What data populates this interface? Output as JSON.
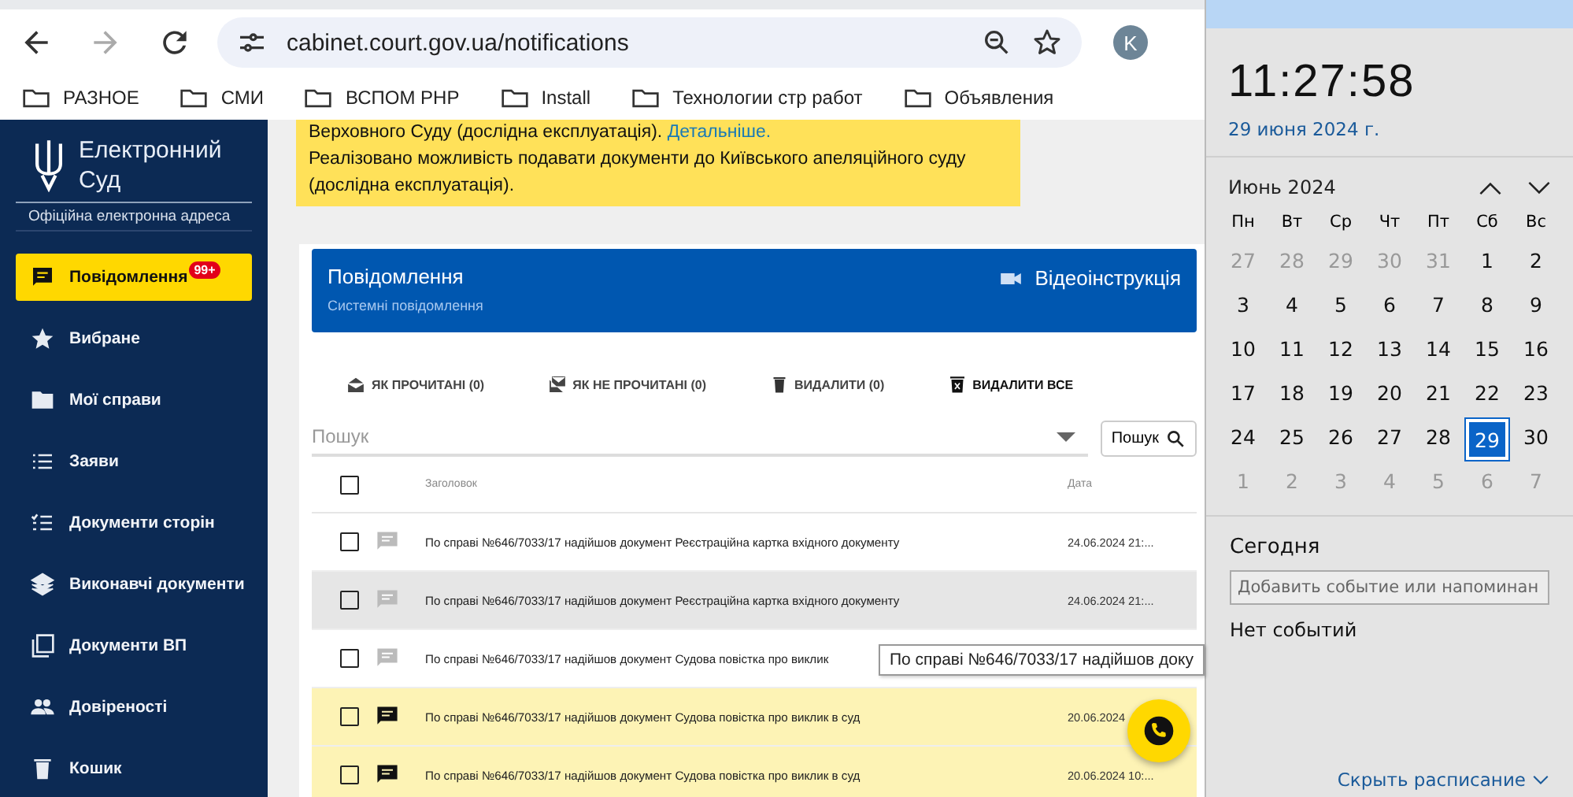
{
  "browser": {
    "url": "cabinet.court.gov.ua/notifications",
    "profile": "K",
    "bookmarks": [
      "РАЗНОЕ",
      "СМИ",
      "ВСПОМ РНР",
      "Install",
      "Технологии стр работ",
      "Объявления"
    ]
  },
  "notice": {
    "line_1": "Верховного Суду (дослідна експлуатація). ",
    "link": "Детальніше.",
    "line_2": "Реалізовано можливість подавати документи до Київського апеляційного суду (дослідна експлуатація)."
  },
  "sidebar": {
    "logo_line_1": "Електронний",
    "logo_line_2": "Суд",
    "subtitle": "Офіційна електронна адреса",
    "items": [
      {
        "label": "Повідомлення",
        "kind": "message",
        "badge": "99+",
        "selected": true
      },
      {
        "label": "Вибране",
        "kind": "star",
        "selected": false
      },
      {
        "label": "Мої справи",
        "kind": "folder",
        "selected": false
      },
      {
        "label": "Заяви",
        "kind": "list",
        "selected": false
      },
      {
        "label": "Документи сторін",
        "kind": "checklist",
        "selected": false
      },
      {
        "label": "Виконавчі документи",
        "kind": "layers",
        "selected": false
      },
      {
        "label": "Документи ВП",
        "kind": "copy",
        "selected": false
      },
      {
        "label": "Довіреності",
        "kind": "people",
        "selected": false
      },
      {
        "label": "Кошик",
        "kind": "trash",
        "selected": false
      }
    ]
  },
  "panel": {
    "title": "Повідомлення",
    "subtitle": "Системні повідомлення",
    "video_link": "Відеоінструкція"
  },
  "actions": [
    {
      "label": "ЯК ПРОЧИТАНІ (0)",
      "kind": "read"
    },
    {
      "label": "ЯК НЕ ПРОЧИТАНІ (0)",
      "kind": "unread"
    },
    {
      "label": "ВИДАЛИТИ (0)",
      "kind": "delete"
    },
    {
      "label": "ВИДАЛИТИ ВСЕ",
      "kind": "delete_all"
    }
  ],
  "search": {
    "placeholder": "Пошук",
    "button": "Пошук"
  },
  "table": {
    "columns": [
      "Заголовок",
      "Дата"
    ],
    "select_all_checked": false,
    "rows": [
      {
        "title": "По справі №646/7033/17 надійшов документ Реєстраційна картка вхідного документу",
        "date": "24.06.2024 21:...",
        "unread": false,
        "highlighted": false,
        "checked": false
      },
      {
        "title": "По справі №646/7033/17 надійшов документ Реєстраційна картка вхідного документу",
        "date": "24.06.2024 21:...",
        "unread": false,
        "highlighted": true,
        "checked": false
      },
      {
        "title": "По справі №646/7033/17 надійшов документ Судова повістка про виклик",
        "unread": false,
        "highlighted": false,
        "checked": false
      },
      {
        "title": "По справі №646/7033/17 надійшов документ Судова повістка про виклик в суд",
        "date": "20.06.2024",
        "unread": true,
        "highlighted": false,
        "checked": false
      },
      {
        "title": "По справі №646/7033/17 надійшов документ Судова повістка про виклик в суд",
        "date": "20.06.2024 10:...",
        "unread": true,
        "highlighted": false,
        "checked": false
      }
    ]
  },
  "tooltip": "По справі №646/7033/17 надійшов доку",
  "calendar": {
    "time": "11:27:58",
    "date": "29 июня 2024 г.",
    "month": "Июнь 2024",
    "weekdays": [
      "Пн",
      "Вт",
      "Ср",
      "Чт",
      "Пт",
      "Сб",
      "Вс"
    ],
    "weeks": [
      [
        {
          "d": "27",
          "outside": true,
          "selected": false
        },
        {
          "d": "28",
          "outside": true,
          "selected": false
        },
        {
          "d": "29",
          "outside": true,
          "selected": false
        },
        {
          "d": "30",
          "outside": true,
          "selected": false
        },
        {
          "d": "31",
          "outside": true,
          "selected": false
        },
        {
          "d": "1",
          "outside": false,
          "selected": false
        },
        {
          "d": "2",
          "outside": false,
          "selected": false
        }
      ],
      [
        {
          "d": "3",
          "outside": false,
          "selected": false
        },
        {
          "d": "4",
          "outside": false,
          "selected": false
        },
        {
          "d": "5",
          "outside": false,
          "selected": false
        },
        {
          "d": "6",
          "outside": false,
          "selected": false
        },
        {
          "d": "7",
          "outside": false,
          "selected": false
        },
        {
          "d": "8",
          "outside": false,
          "selected": false
        },
        {
          "d": "9",
          "outside": false,
          "selected": false
        }
      ],
      [
        {
          "d": "10",
          "outside": false,
          "selected": false
        },
        {
          "d": "11",
          "outside": false,
          "selected": false
        },
        {
          "d": "12",
          "outside": false,
          "selected": false
        },
        {
          "d": "13",
          "outside": false,
          "selected": false
        },
        {
          "d": "14",
          "outside": false,
          "selected": false
        },
        {
          "d": "15",
          "outside": false,
          "selected": false
        },
        {
          "d": "16",
          "outside": false,
          "selected": false
        }
      ],
      [
        {
          "d": "17",
          "outside": false,
          "selected": false
        },
        {
          "d": "18",
          "outside": false,
          "selected": false
        },
        {
          "d": "19",
          "outside": false,
          "selected": false
        },
        {
          "d": "20",
          "outside": false,
          "selected": false
        },
        {
          "d": "21",
          "outside": false,
          "selected": false
        },
        {
          "d": "22",
          "outside": false,
          "selected": false
        },
        {
          "d": "23",
          "outside": false,
          "selected": false
        }
      ],
      [
        {
          "d": "24",
          "outside": false,
          "selected": false
        },
        {
          "d": "25",
          "outside": false,
          "selected": false
        },
        {
          "d": "26",
          "outside": false,
          "selected": false
        },
        {
          "d": "27",
          "outside": false,
          "selected": false
        },
        {
          "d": "28",
          "outside": false,
          "selected": false
        },
        {
          "d": "29",
          "outside": false,
          "selected": true
        },
        {
          "d": "30",
          "outside": false,
          "selected": false
        }
      ],
      [
        {
          "d": "1",
          "outside": true,
          "selected": false
        },
        {
          "d": "2",
          "outside": true,
          "selected": false
        },
        {
          "d": "3",
          "outside": true,
          "selected": false
        },
        {
          "d": "4",
          "outside": true,
          "selected": false
        },
        {
          "d": "5",
          "outside": true,
          "selected": false
        },
        {
          "d": "6",
          "outside": true,
          "selected": false
        },
        {
          "d": "7",
          "outside": true,
          "selected": false
        }
      ]
    ],
    "today_label": "Сегодня",
    "event_placeholder": "Добавить событие или напоминан",
    "no_events": "Нет событий",
    "hide_link": "Скрыть расписание"
  }
}
